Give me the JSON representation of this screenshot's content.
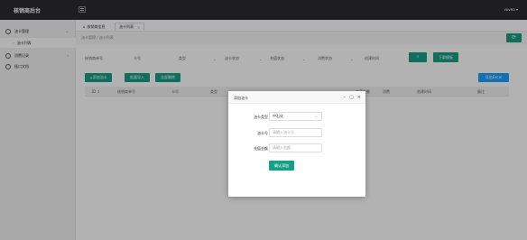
{
  "app": {
    "title": "核销商后台",
    "user": "vuveo"
  },
  "sidebar": {
    "items": [
      {
        "label": "油卡管理",
        "expanded": true
      },
      {
        "label": "油卡列表",
        "sub": true
      },
      {
        "label": "消费记录"
      },
      {
        "label": "插口文档"
      }
    ]
  },
  "tabs": [
    {
      "label": "核销商信息"
    },
    {
      "label": "油卡列表",
      "close": "×"
    }
  ],
  "breadcrumb": "油卡管理 / 油卡列表",
  "filters": {
    "merchant_no": "核销商单号",
    "card_no": "卡号",
    "type": "类型",
    "oil_status": "油卡状态",
    "charge_status": "充值状态",
    "consume_status": "消费状态",
    "created_time": "创建时间"
  },
  "buttons": {
    "search_icon": "search-icon",
    "download_template": "下载模板",
    "add_card": "添加油卡",
    "batch_import": "批量导入",
    "batch_delete": "全部删除",
    "export_excel": "导出Excel",
    "refresh_icon": "refresh-icon"
  },
  "table_headers": [
    "ID ↕",
    "核销商单号",
    "卡号",
    "类型",
    "",
    "",
    "",
    "",
    "充值金额",
    "消费",
    "创建时间",
    "备注"
  ],
  "modal": {
    "title": "添加油卡",
    "controls": [
      "–",
      "▢",
      "×"
    ],
    "fields": {
      "card_type_label": "油卡类型",
      "card_type_value": "中石化",
      "card_no_label": "油卡号",
      "card_no_placeholder": "请输入油卡号",
      "amount_label": "充值金额",
      "amount_placeholder": "请输入金额"
    },
    "confirm": "确认添加"
  },
  "colors": {
    "primary": "#16a085",
    "export": "#1e9fff",
    "topbar": "#2b2c2e"
  }
}
